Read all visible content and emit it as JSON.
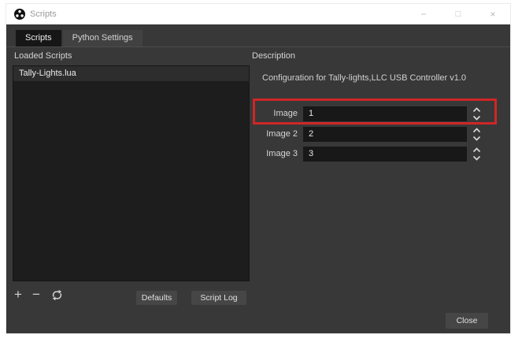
{
  "window": {
    "title": "Scripts",
    "controls": {
      "minimize": "−",
      "maximize": "□",
      "close": "×"
    }
  },
  "tabs": {
    "scripts": "Scripts",
    "python_settings": "Python Settings"
  },
  "left_panel": {
    "heading": "Loaded Scripts",
    "scripts": [
      "Tally-Lights.lua"
    ],
    "toolbar": {
      "add": "+",
      "remove": "−",
      "refresh": "⟳"
    },
    "defaults_label": "Defaults",
    "script_log_label": "Script Log"
  },
  "right_panel": {
    "heading": "Description",
    "description": "Configuration for Tally-lights,LLC USB Controller v1.0",
    "fields": [
      {
        "label": "Image",
        "value": "1",
        "highlighted": true
      },
      {
        "label": "Image 2",
        "value": "2",
        "highlighted": false
      },
      {
        "label": "Image 3",
        "value": "3",
        "highlighted": false
      }
    ],
    "highlight_color": "#cf2626"
  },
  "footer": {
    "close_label": "Close"
  },
  "colors": {
    "content_bg": "#383838",
    "field_bg": "#181818",
    "list_bg": "#1d1d1d",
    "selected_row_bg": "#2d2d2d",
    "button_bg": "#464646",
    "active_tab_bg": "#161616",
    "annotation_red": "#cf2626"
  }
}
